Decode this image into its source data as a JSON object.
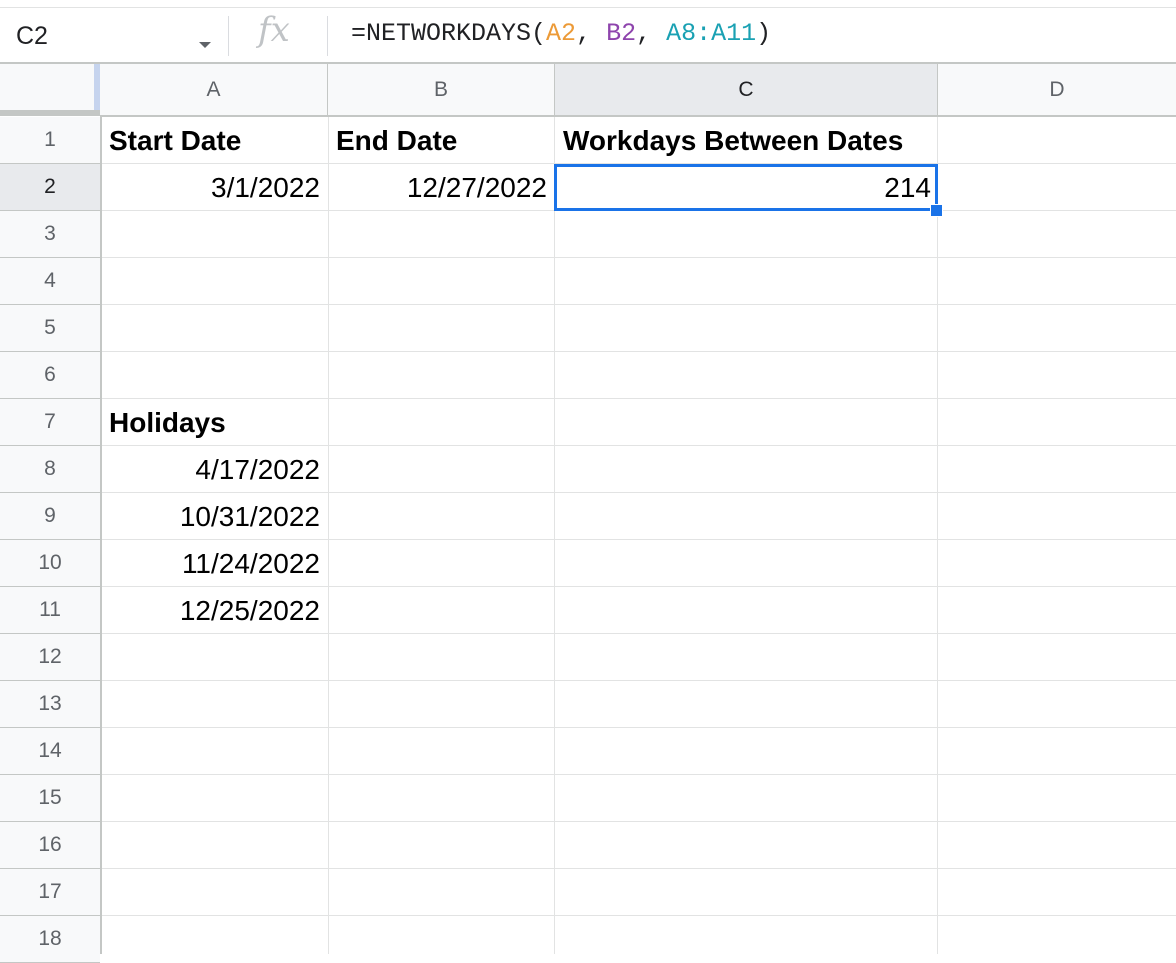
{
  "formula_bar": {
    "name_box": "C2",
    "fx_label": "fx",
    "formula_prefix": "=NETWORKDAYS(",
    "ref_a": "A2",
    "sep1": ", ",
    "ref_b": "B2",
    "sep2": ", ",
    "ref_c": "A8:A11",
    "formula_suffix": ")"
  },
  "columns": [
    "A",
    "B",
    "C",
    "D"
  ],
  "rows": [
    "1",
    "2",
    "3",
    "4",
    "5",
    "6",
    "7",
    "8",
    "9",
    "10",
    "11",
    "12",
    "13",
    "14",
    "15",
    "16",
    "17",
    "18"
  ],
  "cells": {
    "A1": "Start Date",
    "B1": "End Date",
    "C1": "Workdays Between Dates",
    "A2": "3/1/2022",
    "B2": "12/27/2022",
    "C2": "214",
    "A7": "Holidays",
    "A8": "4/17/2022",
    "A9": "10/31/2022",
    "A10": "11/24/2022",
    "A11": "12/25/2022"
  },
  "selection": {
    "cell": "C2",
    "column": "C",
    "row": "2"
  },
  "colors": {
    "selection": "#1a73e8",
    "ref_a": "#ec9a37",
    "ref_b": "#8e44ad",
    "ref_c": "#1aa1b3"
  }
}
